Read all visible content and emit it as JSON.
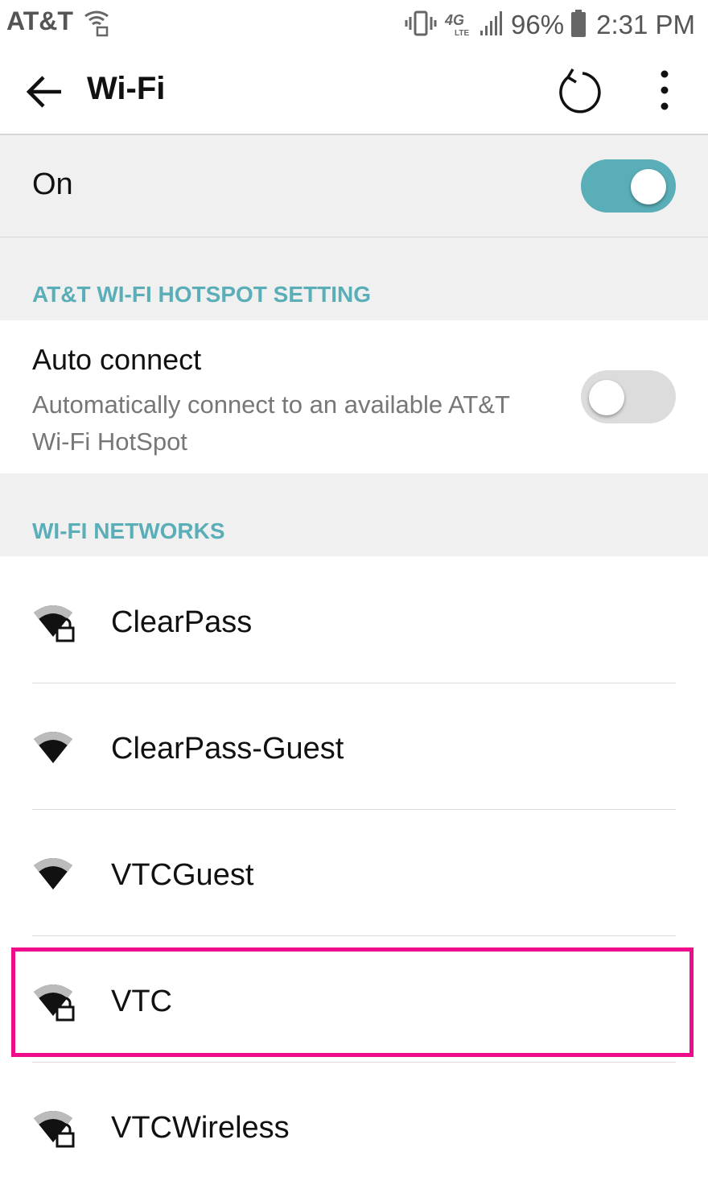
{
  "status_bar": {
    "carrier": "AT&T",
    "network_type": "4G LTE",
    "battery": "96%",
    "time": "2:31 PM"
  },
  "header": {
    "title": "Wi-Fi",
    "back_icon": "arrow-back-icon",
    "refresh_icon": "refresh-icon",
    "more_icon": "more-vert-icon"
  },
  "wifi_toggle": {
    "label": "On",
    "state": true
  },
  "hotspot_section": {
    "header": "AT&T WI-FI HOTSPOT SETTING",
    "auto_connect": {
      "title": "Auto connect",
      "description": "Automatically connect to an available AT&T Wi-Fi HotSpot",
      "state": false
    }
  },
  "networks_section": {
    "header": "WI-FI NETWORKS",
    "items": [
      {
        "name": "ClearPass",
        "secured": true
      },
      {
        "name": "ClearPass-Guest",
        "secured": false
      },
      {
        "name": "VTCGuest",
        "secured": false
      },
      {
        "name": "VTC",
        "secured": true,
        "highlighted": true
      },
      {
        "name": "VTCWireless",
        "secured": true
      }
    ]
  },
  "colors": {
    "accent": "#5aaeb8",
    "highlight": "#ee0c8c",
    "section_bg": "#f0f0f0"
  }
}
